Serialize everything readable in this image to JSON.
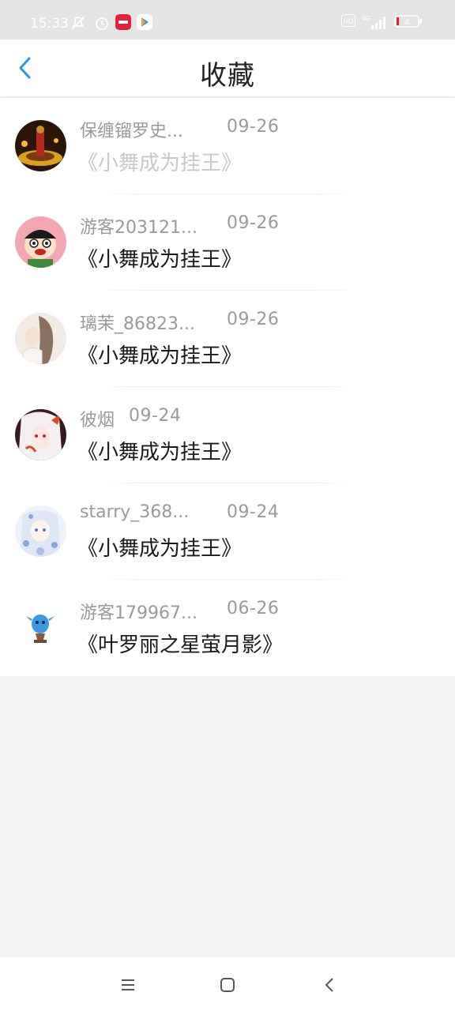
{
  "status_bar": {
    "time": "15:33",
    "network": "4G",
    "hd": "HD",
    "battery": "4"
  },
  "header": {
    "title": "收藏",
    "back_icon": "chevron-left-icon",
    "accent_color": "#2a9ae8"
  },
  "favorites": [
    {
      "user": "保缠镏罗史...",
      "date": "09-26",
      "title": "《小舞成为挂王》",
      "faded": true
    },
    {
      "user": "游客203121...",
      "date": "09-26",
      "title": "《小舞成为挂王》",
      "faded": false
    },
    {
      "user": "璃茉_86823...",
      "date": "09-26",
      "title": "《小舞成为挂王》",
      "faded": false
    },
    {
      "user": "彼烟",
      "date": "09-24",
      "title": "《小舞成为挂王》",
      "faded": false
    },
    {
      "user": "starry_368...",
      "date": "09-24",
      "title": "《小舞成为挂王》",
      "faded": false
    },
    {
      "user": "游客179967...",
      "date": "06-26",
      "title": "《叶罗丽之星萤月影》",
      "faded": false
    }
  ],
  "nav_bar": {
    "icons": [
      "menu-icon",
      "home-square-icon",
      "back-chevron-icon"
    ]
  }
}
